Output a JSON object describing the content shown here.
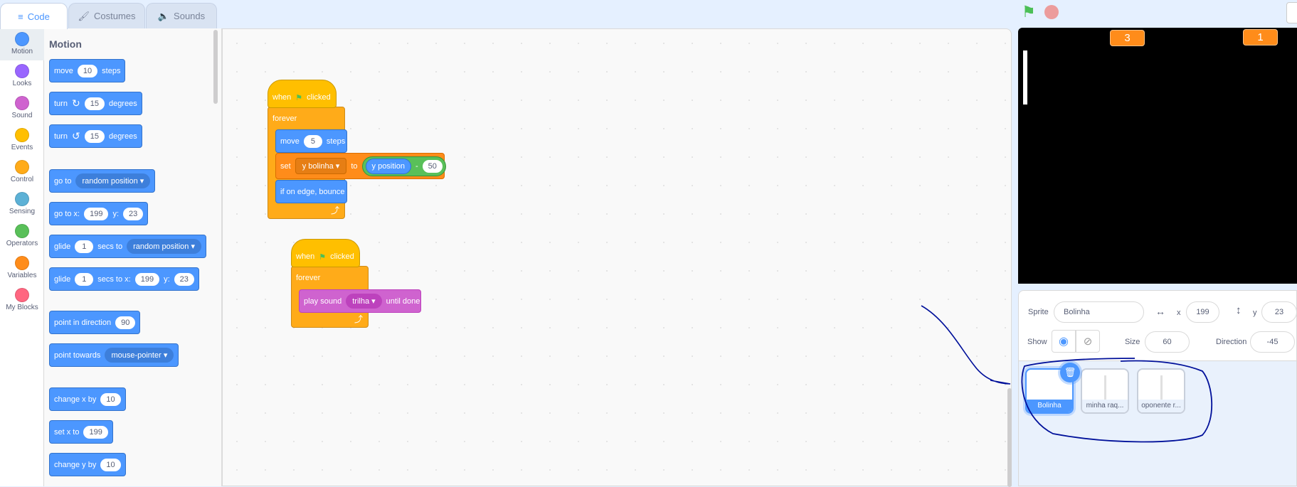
{
  "tabs": [
    {
      "label": "Code",
      "icon": "code-icon"
    },
    {
      "label": "Costumes",
      "icon": "brush-icon"
    },
    {
      "label": "Sounds",
      "icon": "speaker-icon"
    }
  ],
  "categories": [
    {
      "label": "Motion",
      "color": "#4c97ff"
    },
    {
      "label": "Looks",
      "color": "#9966ff"
    },
    {
      "label": "Sound",
      "color": "#cf63cf"
    },
    {
      "label": "Events",
      "color": "#ffbf00"
    },
    {
      "label": "Control",
      "color": "#ffab19"
    },
    {
      "label": "Sensing",
      "color": "#5cb1d6"
    },
    {
      "label": "Operators",
      "color": "#59c059"
    },
    {
      "label": "Variables",
      "color": "#ff8c1a"
    },
    {
      "label": "My Blocks",
      "color": "#ff6680"
    }
  ],
  "palette": {
    "title": "Motion",
    "blocks": [
      [
        {
          "t": "move"
        },
        {
          "i": "10"
        },
        {
          "t": "steps"
        }
      ],
      [
        {
          "t": "turn"
        },
        {
          "icon": "↻"
        },
        {
          "i": "15"
        },
        {
          "t": "degrees"
        }
      ],
      [
        {
          "t": "turn"
        },
        {
          "icon": "↺"
        },
        {
          "i": "15"
        },
        {
          "t": "degrees"
        }
      ],
      [
        {
          "t": "go to"
        },
        {
          "d": "random position"
        }
      ],
      [
        {
          "t": "go to x:"
        },
        {
          "i": "199"
        },
        {
          "t": "y:"
        },
        {
          "i": "23"
        }
      ],
      [
        {
          "t": "glide"
        },
        {
          "i": "1"
        },
        {
          "t": "secs to"
        },
        {
          "d": "random position"
        }
      ],
      [
        {
          "t": "glide"
        },
        {
          "i": "1"
        },
        {
          "t": "secs to x:"
        },
        {
          "i": "199"
        },
        {
          "t": "y:"
        },
        {
          "i": "23"
        }
      ],
      [
        {
          "t": "point in direction"
        },
        {
          "i": "90"
        }
      ],
      [
        {
          "t": "point towards"
        },
        {
          "d": "mouse-pointer"
        }
      ],
      [
        {
          "t": "change x by"
        },
        {
          "i": "10"
        }
      ],
      [
        {
          "t": "set x to"
        },
        {
          "i": "199"
        }
      ],
      [
        {
          "t": "change y by"
        },
        {
          "i": "10"
        }
      ]
    ]
  },
  "scripts": {
    "s1": {
      "when": "when",
      "clicked": "clicked",
      "forever": "forever",
      "move": "move",
      "move_val": "5",
      "steps": "steps",
      "set": "set",
      "var": "y bolinha",
      "to": "to",
      "reporter": "y position",
      "minus": "-",
      "num": "50",
      "bounce": "if on edge, bounce"
    },
    "s2": {
      "when": "when",
      "clicked": "clicked",
      "forever": "forever",
      "play": "play sound",
      "sound": "trilha",
      "until": "until done"
    }
  },
  "stage": {
    "score_left": "3",
    "score_right": "1"
  },
  "sprite_info": {
    "sprite_label": "Sprite",
    "sprite_name": "Bolinha",
    "x_label": "x",
    "x": "199",
    "y_label": "y",
    "y": "23",
    "show_label": "Show",
    "size_label": "Size",
    "size": "60",
    "direction_label": "Direction",
    "direction": "-45"
  },
  "sprites": [
    {
      "name": "Bolinha",
      "selected": true
    },
    {
      "name": "minha raq..."
    },
    {
      "name": "oponente r..."
    }
  ],
  "annotation_color": "#00109a"
}
